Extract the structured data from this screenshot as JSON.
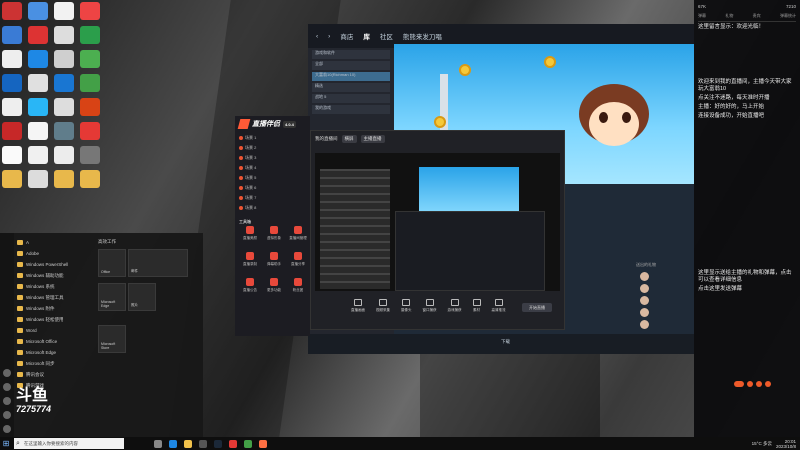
{
  "steam": {
    "nav": [
      "商店",
      "库",
      "社区",
      "熊熊来发刀唱"
    ],
    "download_status": "下载",
    "sidebar_rows": [
      "游戏和软件",
      "全部",
      "大富翁10(Richman 10)",
      "精选",
      "战地 5",
      "我的游戏"
    ]
  },
  "launcher": {
    "brand": "直播伴侣",
    "badge": "4.0.4",
    "scene_rows": [
      "场景 1",
      "场景 2",
      "场景 3",
      "场景 4",
      "场景 5",
      "场景 6",
      "场景 7",
      "场景 8"
    ],
    "tools_title": "工具箱",
    "tools": [
      "直播美颜",
      "虚拟形象",
      "直播间管理",
      "直播录制",
      "弹幕助手",
      "直播分享",
      "直播公告",
      "更多功能",
      "粉丝团"
    ]
  },
  "obs": {
    "title": "我的直播间",
    "mode_pill": "横屏",
    "scene_pill": "主播直播",
    "tools": [
      "直播画面",
      "视频采集",
      "摄像头",
      "窗口捕获",
      "游戏捕获",
      "素材",
      "高清推流"
    ],
    "start_button": "开始直播"
  },
  "danmaku": {
    "count": "67K",
    "viewers": "7210",
    "tabs": [
      "弹幕",
      "礼物",
      "贵宾",
      "弹幕统计"
    ],
    "messages": [
      "这里留言显示：欢迎光临！",
      "欢迎来到我的直播间，主播今天带大家玩大富翁10",
      "点关注不迷路，每天准时开播",
      "主播：好的好的，马上开始",
      "连接设备成功，开始直播吧",
      "这里显示送给主播的礼物和弹幕，点击可以查看详细信息",
      "点击这里发送弹幕"
    ],
    "gift_title": "送出的礼物"
  },
  "start_menu": {
    "items": [
      "A",
      "Adobe",
      "Windows PowerShell",
      "Windows 辅助功能",
      "Windows 系统",
      "Windows 管理工具",
      "Windows 附件",
      "Windows 轻松使用",
      "Word",
      "Microsoft Office",
      "Microsoft Edge",
      "Microsoft 同步",
      "腾讯会议",
      "腾讯游戏"
    ],
    "tiles_header": "高效工作",
    "tiles": [
      "Office",
      "邮件",
      "Microsoft Edge",
      "照片",
      "Microsoft Store"
    ]
  },
  "watermark": {
    "line1": "斗鱼",
    "line2": "7275774"
  },
  "taskbar": {
    "search_placeholder": "在这里输入你要搜索的内容",
    "weather": "15°C 多云",
    "time": "20:01",
    "date": "2023/10/8"
  },
  "colors": {
    "accent_orange": "#ee5a2a",
    "steam_bg": "#1b2027",
    "banner_sky": "#2aa3e8"
  }
}
